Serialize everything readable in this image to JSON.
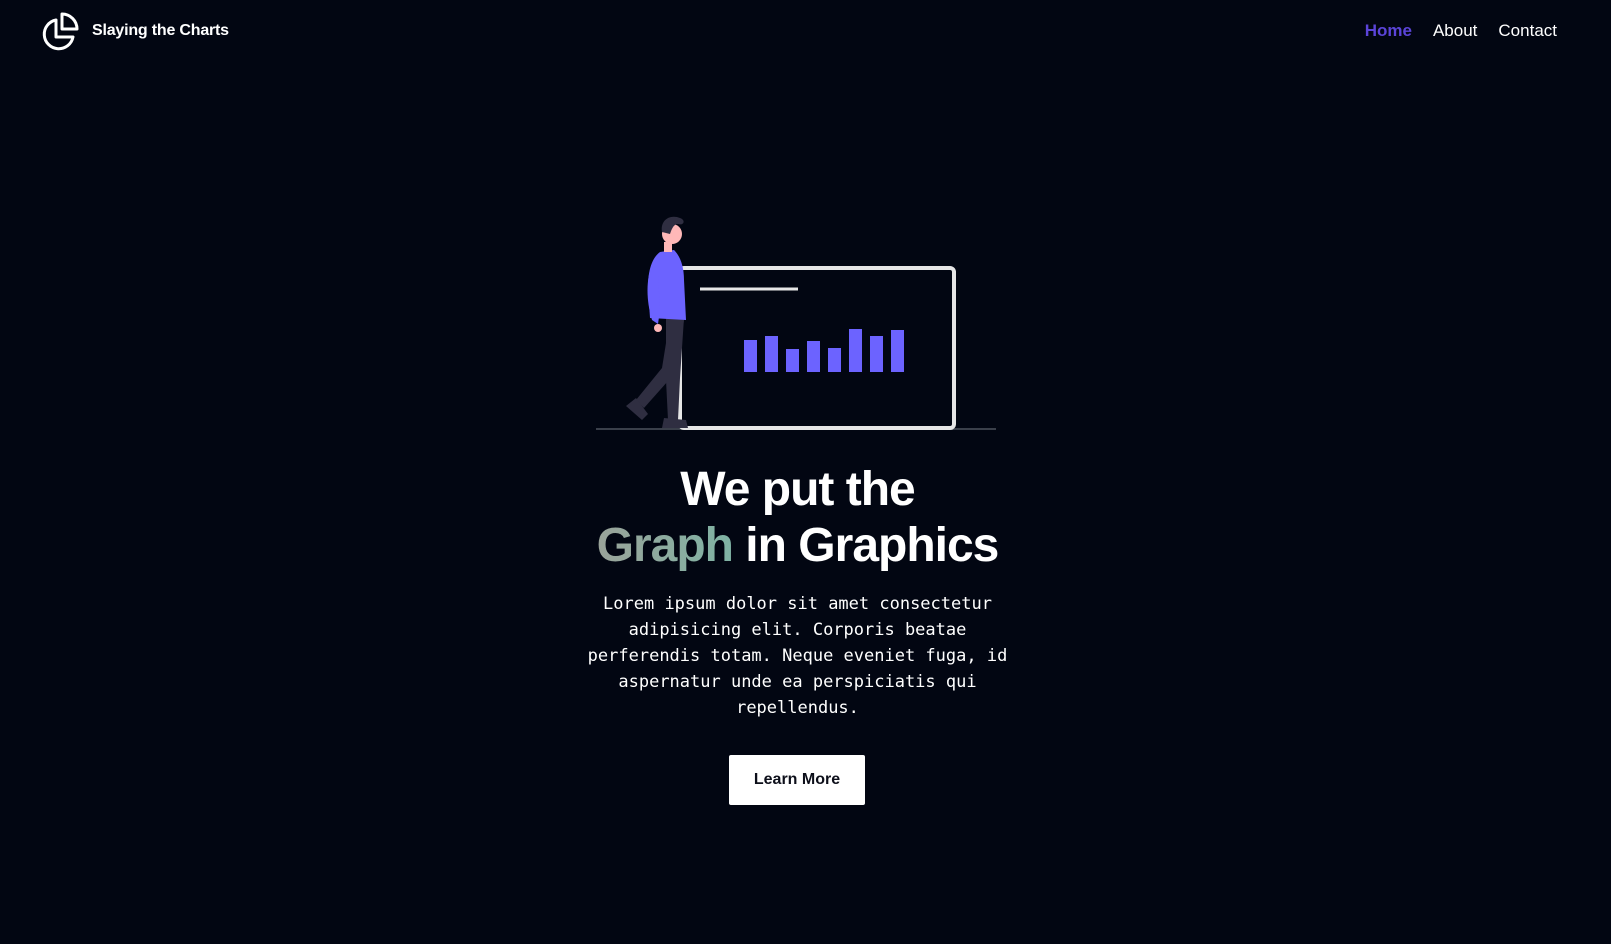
{
  "header": {
    "brand_name": "Slaying the Charts",
    "logo_icon": "pie-chart-icon",
    "nav": [
      {
        "label": "Home",
        "active": true
      },
      {
        "label": "About",
        "active": false
      },
      {
        "label": "Contact",
        "active": false
      }
    ]
  },
  "hero": {
    "illustration": "person-presenting-bar-chart-illustration",
    "headline_line1": "We put the",
    "headline_accent": "Graph",
    "headline_rest": " in Graphics",
    "description": "Lorem ipsum dolor sit amet consectetur adipisicing elit. Corporis beatae perferendis totam. Neque eveniet fuga, id aspernatur unde ea perspiciatis qui repellendus.",
    "cta_label": "Learn More"
  },
  "colors": {
    "background": "#020612",
    "nav_active": "#5b44d8",
    "accent_gradient_start": "#9aa39a",
    "accent_gradient_end": "#7fb3a4",
    "illustration_purple": "#6c63ff",
    "button_bg": "#ffffff"
  }
}
